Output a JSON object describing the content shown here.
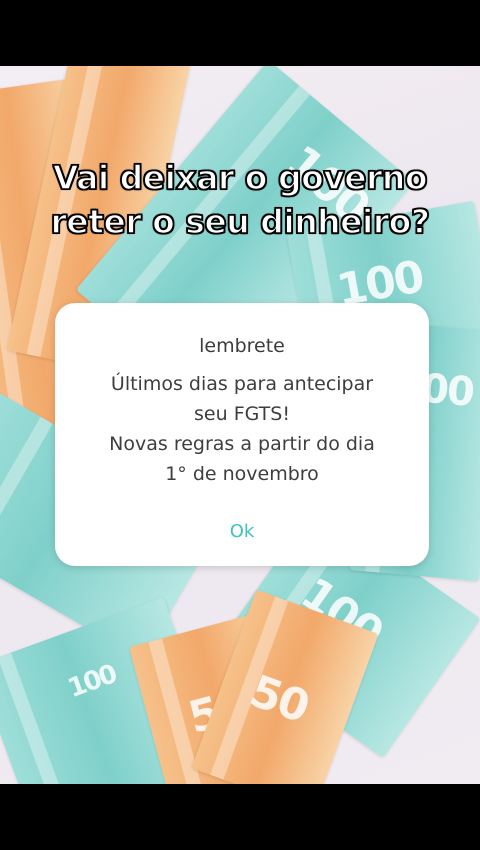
{
  "video_caption": {
    "line1": "Vai deixar o governo",
    "line2": "reter o seu dinheiro?"
  },
  "dialog": {
    "title": "lembrete",
    "message_lines": [
      "Últimos dias para antecipar",
      "seu FGTS!",
      "Novas regras a partir do dia",
      "1° de novembro"
    ],
    "ok_label": "Ok"
  },
  "background_notes": {
    "denominations": [
      "100",
      "100",
      "100",
      "100",
      "50",
      "50",
      "100"
    ]
  },
  "colors": {
    "accent": "#3fc2c0",
    "dialog_bg": "#ffffff",
    "caption_fill": "#ffffff",
    "caption_stroke": "#000000",
    "letterbox": "#000000"
  }
}
